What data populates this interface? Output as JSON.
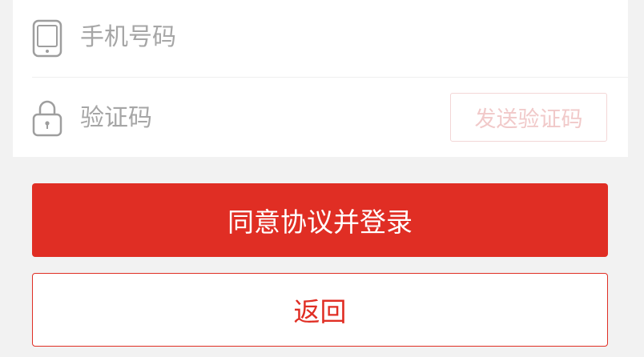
{
  "form": {
    "phone": {
      "value": "",
      "placeholder": "手机号码",
      "icon": "phone-icon"
    },
    "code": {
      "value": "",
      "placeholder": "验证码",
      "icon": "lock-icon",
      "send_label": "发送验证码"
    }
  },
  "actions": {
    "login_label": "同意协议并登录",
    "back_label": "返回"
  },
  "colors": {
    "accent": "#e02e24",
    "send_disabled_text": "#f1c9c9",
    "send_disabled_border": "#f3d6d6",
    "placeholder": "#a6a6a6",
    "icon": "#9e9e9e",
    "background": "#f2f2f2"
  }
}
